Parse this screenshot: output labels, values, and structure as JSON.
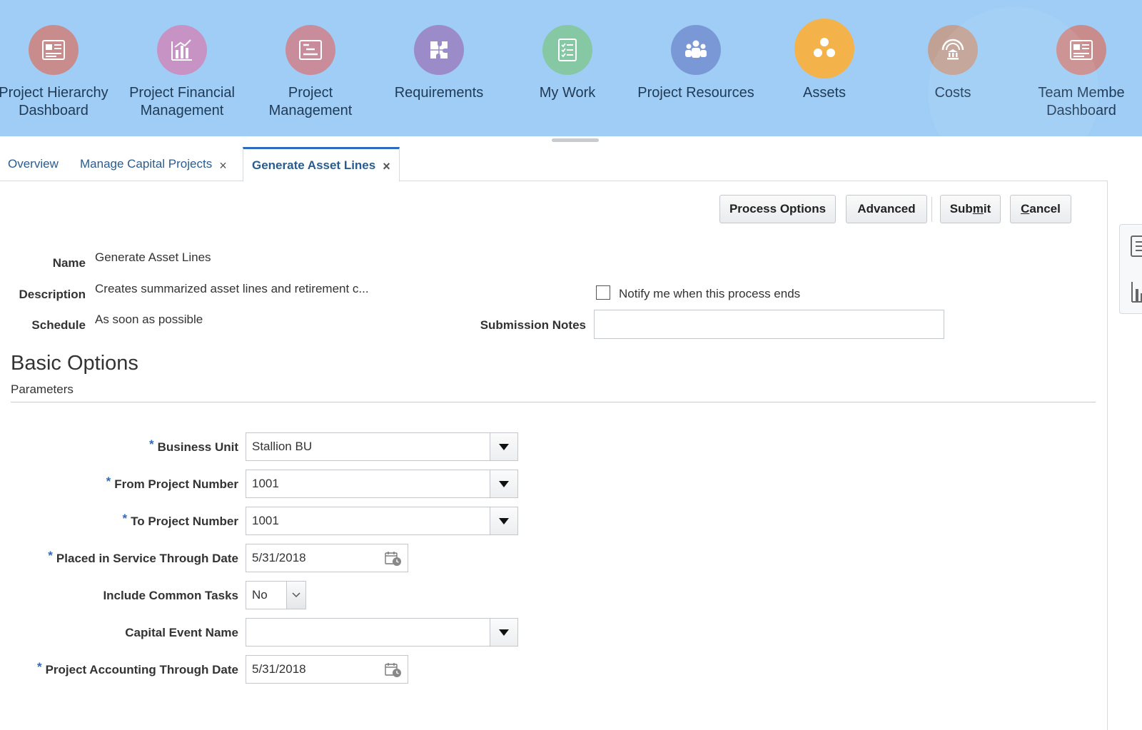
{
  "nav": {
    "items": [
      {
        "label_1": "Project Hierarchy",
        "label_2": "Dashboard",
        "color": "#c98c8c",
        "icon": "dashboard-icon"
      },
      {
        "label_1": "Project Financial",
        "label_2": "Management",
        "color": "#c693c4",
        "icon": "bar-chart-icon"
      },
      {
        "label_1": "Project",
        "label_2": "Management",
        "color": "#c98c9a",
        "icon": "gantt-icon"
      },
      {
        "label_1": "Requirements",
        "label_2": "",
        "color": "#9b8bc9",
        "icon": "puzzle-icon"
      },
      {
        "label_1": "My Work",
        "label_2": "",
        "color": "#86c7a4",
        "icon": "checklist-icon"
      },
      {
        "label_1": "Project Resources",
        "label_2": "",
        "color": "#7b98d6",
        "icon": "people-icon"
      },
      {
        "label_1": "Assets",
        "label_2": "",
        "color": "#f3b34a",
        "icon": "assets-icon"
      },
      {
        "label_1": "Costs",
        "label_2": "",
        "color": "#c2a195",
        "icon": "bank-icon"
      },
      {
        "label_1": "Team Membe",
        "label_2": "Dashboard",
        "color": "#c98c8c",
        "icon": "dashboard-icon"
      }
    ]
  },
  "tabs": {
    "overview": "Overview",
    "manage": "Manage Capital Projects",
    "generate": "Generate Asset Lines",
    "close_glyph": "×"
  },
  "buttons": {
    "process_options": "Process Options",
    "advanced": "Advanced",
    "submit_pre": "Sub",
    "submit_key": "m",
    "submit_post": "it",
    "cancel_key": "C",
    "cancel_post": "ancel"
  },
  "header": {
    "name_label": "Name",
    "name_value": "Generate Asset Lines",
    "description_label": "Description",
    "description_value": "Creates summarized asset lines and retirement c...",
    "schedule_label": "Schedule",
    "schedule_value": "As soon as possible",
    "notify_label": "Notify me when this process ends",
    "submission_notes_label": "Submission Notes",
    "submission_notes_value": ""
  },
  "section": {
    "title": "Basic Options",
    "subtitle": "Parameters"
  },
  "params": {
    "required_mark": "*",
    "business_unit_label": "Business Unit",
    "business_unit_value": "Stallion BU",
    "from_project_label": "From Project Number",
    "from_project_value": "1001",
    "to_project_label": "To Project Number",
    "to_project_value": "1001",
    "placed_in_service_label": "Placed in Service Through Date",
    "placed_in_service_value": "5/31/2018",
    "include_common_label": "Include Common Tasks",
    "include_common_value": "No",
    "capital_event_label": "Capital Event Name",
    "capital_event_value": "",
    "pa_through_label": "Project Accounting Through Date",
    "pa_through_value": "5/31/2018"
  }
}
